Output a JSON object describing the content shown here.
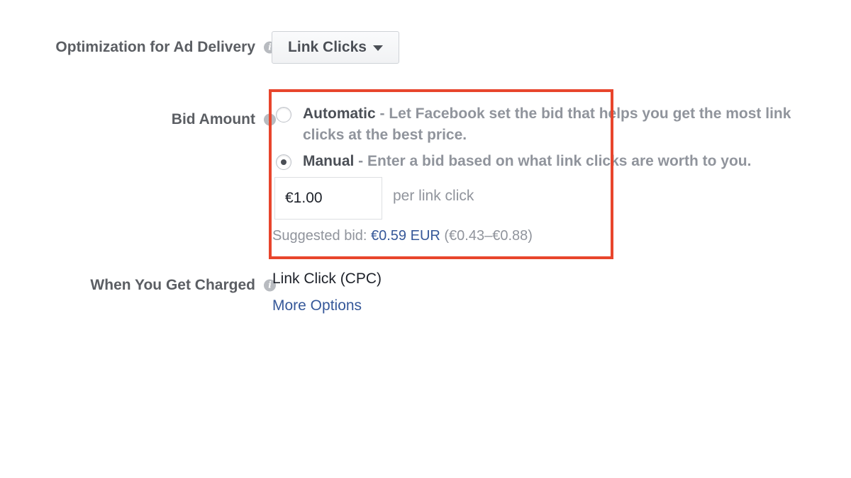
{
  "optimization": {
    "label": "Optimization for Ad Delivery",
    "dropdown_value": "Link Clicks"
  },
  "bid": {
    "label": "Bid Amount",
    "options": [
      {
        "title": "Automatic",
        "description": " - Let Facebook set the bid that helps you get the most link clicks at the best price.",
        "selected": false
      },
      {
        "title": "Manual",
        "description": " - Enter a bid based on what link clicks are worth to you.",
        "selected": true
      }
    ],
    "input_value": "€1.00",
    "unit_label": "per link click",
    "suggested_prefix": "Suggested bid: ",
    "suggested_amount": "€0.59 EUR",
    "suggested_range": " (€0.43–€0.88)"
  },
  "charged": {
    "label": "When You Get Charged",
    "value": "Link Click (CPC)",
    "more_options": "More Options"
  },
  "icons": {
    "info": "info-icon",
    "dropdown": "caret-down-icon"
  },
  "colors": {
    "highlight": "#e8452c",
    "link": "#365899"
  }
}
